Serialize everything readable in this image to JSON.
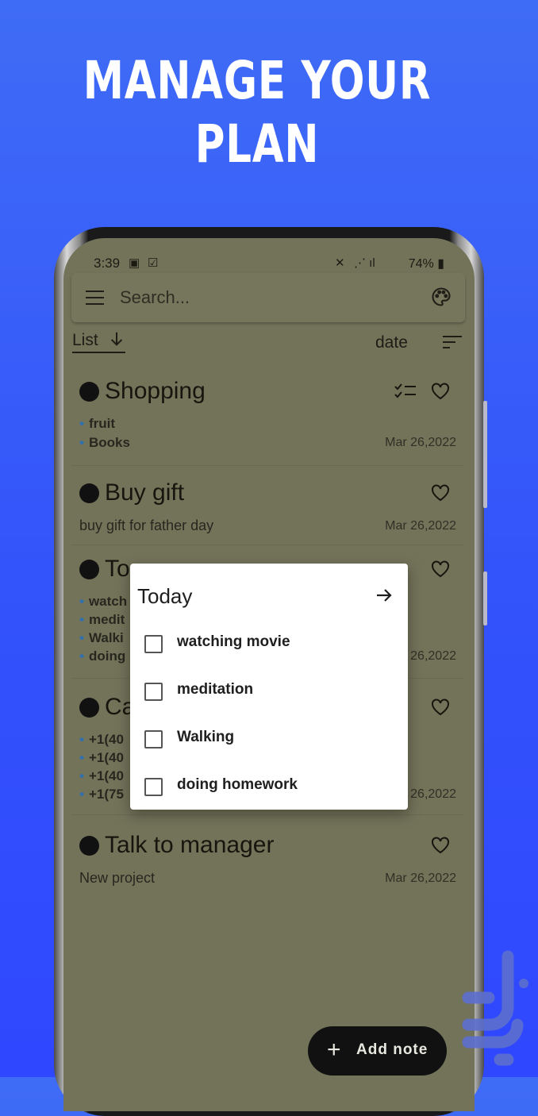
{
  "promo": {
    "headline": "MANAGE YOUR PLAN"
  },
  "statusbar": {
    "time": "3:39",
    "battery": "74%"
  },
  "search": {
    "placeholder": "Search..."
  },
  "toolbar": {
    "view_label": "List",
    "sort_label": "date"
  },
  "notes": [
    {
      "title": "Shopping",
      "items": [
        "fruit",
        "Books"
      ],
      "date": "Mar 26,2022"
    },
    {
      "title": "Buy gift",
      "description": "buy gift for father day",
      "date": "Mar 26,2022"
    },
    {
      "title": "To",
      "items": [
        "watch",
        "medit",
        "Walki",
        "doing"
      ],
      "date": "26,2022"
    },
    {
      "title": "Ca",
      "items": [
        "+1(40",
        "+1(40",
        "+1(40",
        "+1(75"
      ],
      "date": "26,2022"
    },
    {
      "title": "Talk to manager",
      "description": "New project",
      "date": "Mar 26,2022"
    }
  ],
  "dialog": {
    "title": "Today",
    "items": [
      "watching movie",
      "meditation",
      "Walking",
      "doing homework"
    ]
  },
  "fab": {
    "plus": "+",
    "label": "Add note"
  },
  "colors": {
    "background": "#3353fb",
    "overlay": "#73735a",
    "bullet": "#2f6fb0"
  }
}
